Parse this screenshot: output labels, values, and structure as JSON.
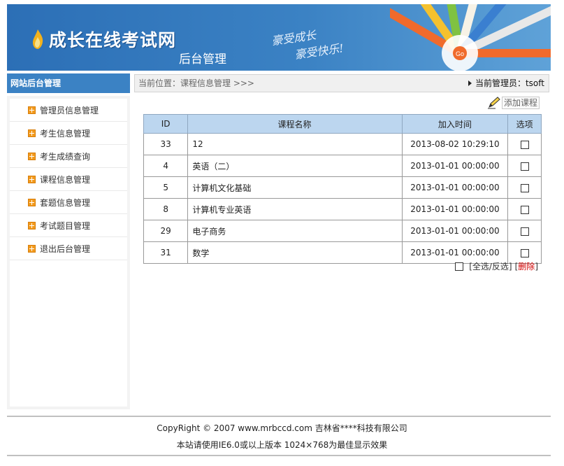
{
  "header": {
    "site_title": "成长在线考试网",
    "subtitle": "后台管理",
    "slogan_line1": "豪受成长",
    "slogan_line2": "豪受快乐!",
    "badge": "Go"
  },
  "sidebar": {
    "title": "网站后台管理",
    "items": [
      {
        "label": "管理员信息管理"
      },
      {
        "label": "考生信息管理"
      },
      {
        "label": "考生成绩查询"
      },
      {
        "label": "课程信息管理"
      },
      {
        "label": "套题信息管理"
      },
      {
        "label": "考试题目管理"
      },
      {
        "label": "退出后台管理"
      }
    ]
  },
  "topbar": {
    "breadcrumb": "当前位置：课程信息管理 >>>",
    "admin": "当前管理员：tsoft"
  },
  "actions": {
    "add_course": "添加课程"
  },
  "table": {
    "headers": [
      "ID",
      "课程名称",
      "加入时间",
      "选项"
    ],
    "rows": [
      {
        "id": "33",
        "name": "12",
        "time": "2013-08-02 10:29:10"
      },
      {
        "id": "4",
        "name": "英语（二）",
        "time": "2013-01-01 00:00:00"
      },
      {
        "id": "5",
        "name": "计算机文化基础",
        "time": "2013-01-01 00:00:00"
      },
      {
        "id": "8",
        "name": "计算机专业英语",
        "time": "2013-01-01 00:00:00"
      },
      {
        "id": "29",
        "name": "电子商务",
        "time": "2013-01-01 00:00:00"
      },
      {
        "id": "31",
        "name": "数学",
        "time": "2013-01-01 00:00:00"
      }
    ]
  },
  "bulk": {
    "select_all": "[全选/反选]",
    "bracket_open": "[",
    "delete": "删除",
    "bracket_close": "]"
  },
  "footer": {
    "line1": "CopyRight © 2007 www.mrbccd.com 吉林省****科技有限公司",
    "line2": "本站请使用IE6.0或以上版本 1024×768为最佳显示效果"
  },
  "colors": {
    "header_blue": "#3b82c4",
    "table_header": "#bcd6ef",
    "icon_orange": "#f39a1c",
    "delete_red": "#d20000"
  }
}
